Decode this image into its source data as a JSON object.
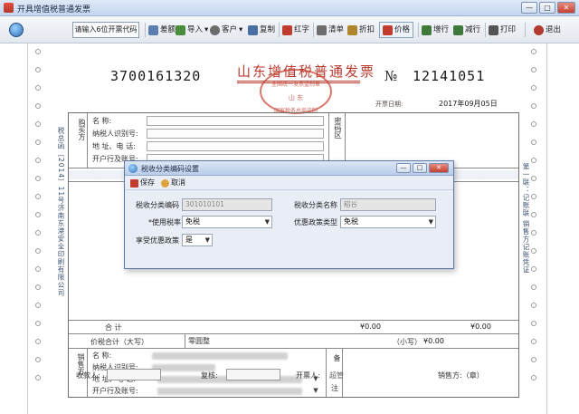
{
  "window": {
    "title": "开具增值税普通发票",
    "controls": [
      "—",
      "□",
      "✕"
    ]
  },
  "toolbar": {
    "search_button": "请输入6位开票代码",
    "buttons": [
      {
        "label": "差额",
        "icon": "balance-icon",
        "color": "#5a7fb0"
      },
      {
        "label": "导入",
        "icon": "import-icon",
        "color": "#4a8c3a"
      },
      {
        "label": "客户",
        "icon": "customer-icon",
        "color": "#6b6b6b"
      },
      {
        "label": "复制",
        "icon": "copy-icon",
        "color": "#4b6ea3"
      },
      {
        "label": "红字",
        "icon": "red-invoice-icon",
        "color": "#c23b2f"
      },
      {
        "label": "清单",
        "icon": "list-icon",
        "color": "#6d6d6d"
      },
      {
        "label": "折扣",
        "icon": "discount-icon",
        "color": "#b0852f"
      },
      {
        "label": "价格",
        "icon": "price-icon",
        "color": "#c23b2f"
      },
      {
        "label": "增行",
        "icon": "add-row-icon",
        "color": "#3f7a3a"
      },
      {
        "label": "减行",
        "icon": "remove-row-icon",
        "color": "#3f7a3a"
      },
      {
        "label": "打印",
        "icon": "print-icon",
        "color": "#555555"
      },
      {
        "label": "退出",
        "icon": "exit-icon",
        "color": "#b23a2e"
      }
    ]
  },
  "invoice": {
    "code": "3700161320",
    "title": "山东增值税普通发票",
    "number_sign": "№",
    "number": "12141051",
    "date_label": "开票日期:",
    "date": "2017年09月05日",
    "seal_lines": [
      "全国统一发票监制章",
      "山  东",
      "国家税务总局监制"
    ],
    "left_margin_text": "税总函〔2014〕11号济南东港安全印刷有限公司",
    "right_margin_text": "第一联：记账联 销售方记账凭证",
    "buyer_side": [
      "购",
      "买",
      "方"
    ],
    "buyer_labels": [
      "名    称:",
      "纳税人识别号:",
      "地 址、电 话:",
      "开户行及账号:"
    ],
    "password_area": "密码区",
    "goods_header": "货物或应税",
    "tax_header": "税额",
    "total_label": "合        计",
    "total_amount": "¥0.00",
    "total_tax": "¥0.00",
    "price_tax_label": "价税合计（大写）",
    "price_tax_text": "零圆整",
    "lowercase_label": "（小写）",
    "lowercase_amount": "¥0.00",
    "seller_side": [
      "销",
      "售",
      "方"
    ],
    "seller_labels": [
      "名    称:",
      "纳税人识别号:",
      "地 址、电 话:",
      "开户行及账号:"
    ],
    "remarks_side": [
      "备",
      "注"
    ],
    "payee_label": "收款人:",
    "reviewer_label": "复核:",
    "drawer_label": "开票人:",
    "drawer_name": "超管",
    "seller_stamp_label": "销售方:（章）"
  },
  "dialog": {
    "title": "税收分类编码设置",
    "save_label": "保存",
    "cancel_label": "取消",
    "tax_code_label": "税收分类编码",
    "tax_code_value": "301010101",
    "tax_name_label": "税收分类名称",
    "tax_name_value": "稻谷",
    "tax_rate_label": "*使用税率",
    "tax_rate_value": "免税",
    "policy_type_label": "优惠政策类型",
    "policy_type_value": "免税",
    "enjoy_label": "享受优惠政策",
    "enjoy_value": "是"
  }
}
